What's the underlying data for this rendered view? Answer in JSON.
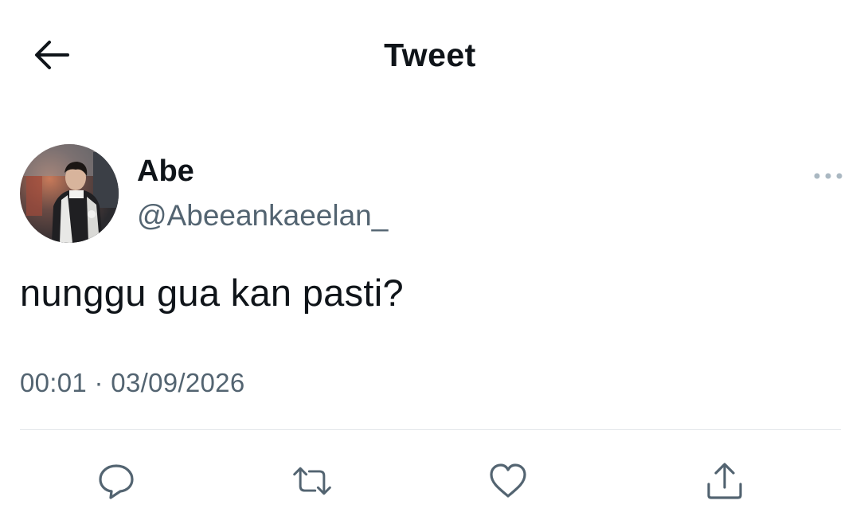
{
  "header": {
    "title": "Tweet",
    "back_icon": "arrow-left-icon"
  },
  "tweet": {
    "author": {
      "display_name": "Abe",
      "handle": "@Abeeankaeelan_"
    },
    "text": "nunggu gua kan pasti?",
    "timestamp": "00:01 · 03/09/2026",
    "more_icon": "more-horizontal-icon"
  },
  "actions": [
    {
      "name": "reply",
      "icon": "reply-icon"
    },
    {
      "name": "retweet",
      "icon": "retweet-icon"
    },
    {
      "name": "like",
      "icon": "heart-icon"
    },
    {
      "name": "share",
      "icon": "share-icon"
    }
  ],
  "colors": {
    "text_primary": "#0f1419",
    "text_secondary": "#536471",
    "divider": "#e6e9ec",
    "icon": "#536471"
  }
}
